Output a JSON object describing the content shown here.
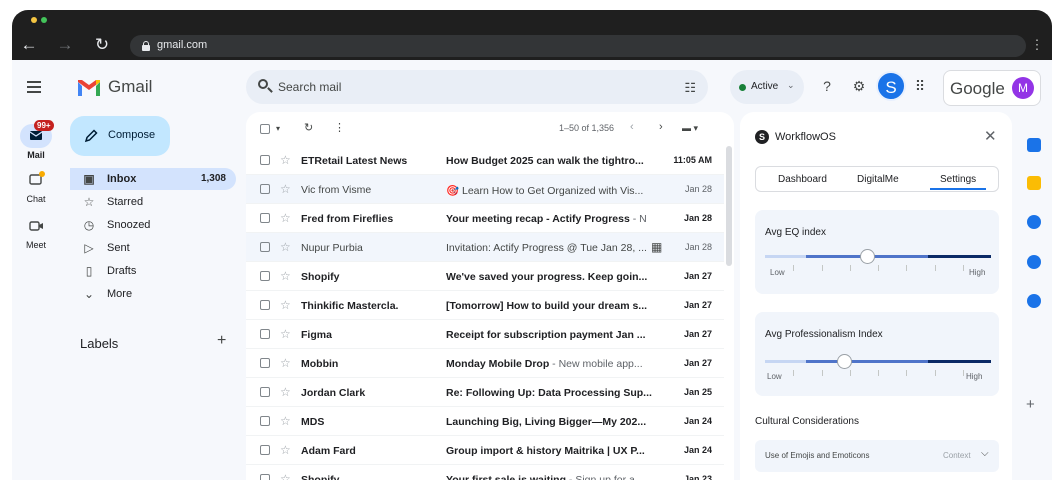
{
  "browser": {
    "url": "gmail.com"
  },
  "app": {
    "name": "Gmail",
    "compose_label": "Compose",
    "rail": [
      {
        "label": "Mail",
        "badge": "99+"
      },
      {
        "label": "Chat"
      },
      {
        "label": "Meet"
      }
    ],
    "nav": [
      {
        "label": "Inbox",
        "count": "1,308",
        "icon": "inbox-icon"
      },
      {
        "label": "Starred",
        "icon": "star-icon"
      },
      {
        "label": "Snoozed",
        "icon": "clock-icon"
      },
      {
        "label": "Sent",
        "icon": "send-icon"
      },
      {
        "label": "Drafts",
        "icon": "draft-icon"
      },
      {
        "label": "More",
        "icon": "chevron-down-icon"
      }
    ],
    "labels_title": "Labels"
  },
  "header": {
    "search_placeholder": "Search mail",
    "status": "Active",
    "avatar_letter": "S",
    "google_text": "Google",
    "account_letter": "M"
  },
  "list": {
    "range": "1–50 of 1,356",
    "rows": [
      {
        "sender": "ETRetail Latest News",
        "subject": "How Budget 2025 can walk the tightro...",
        "snippet": "",
        "date": "11:05 AM",
        "unread": true
      },
      {
        "sender": "Vic from Visme",
        "subject": "🎯 Learn How to Get Organized with Vis...",
        "snippet": "",
        "date": "Jan 28",
        "unread": false
      },
      {
        "sender": "Fred from Fireflies",
        "subject": "Your meeting recap - Actify Progress",
        "snippet": " - N",
        "date": "Jan 28",
        "unread": true
      },
      {
        "sender": "Nupur Purbia",
        "subject": "Invitation: Actify Progress @ Tue Jan 28, ...",
        "snippet": "",
        "date": "Jan 28",
        "unread": false
      },
      {
        "sender": "Shopify",
        "subject": "We've saved your progress. Keep goin...",
        "snippet": "",
        "date": "Jan 27",
        "unread": true
      },
      {
        "sender": "Thinkific Mastercla.",
        "subject": "[Tomorrow] How to build your dream s...",
        "snippet": "",
        "date": "Jan 27",
        "unread": true
      },
      {
        "sender": "Figma",
        "subject": "Receipt for subscription payment Jan ...",
        "snippet": "",
        "date": "Jan 27",
        "unread": true
      },
      {
        "sender": "Mobbin",
        "subject": "Monday Mobile Drop",
        "snippet": " - New mobile app...",
        "date": "Jan 27",
        "unread": true
      },
      {
        "sender": "Jordan Clark",
        "subject": "Re: Following Up: Data Processing Sup...",
        "snippet": "",
        "date": "Jan 25",
        "unread": true
      },
      {
        "sender": "MDS",
        "subject": "Launching Big, Living Bigger—My 202...",
        "snippet": "",
        "date": "Jan 24",
        "unread": true
      },
      {
        "sender": "Adam Fard",
        "subject": "Group import & history Maitrika | UX P...",
        "snippet": "",
        "date": "Jan 24",
        "unread": true
      },
      {
        "sender": "Shopify",
        "subject": "Your first sale is waiting",
        "snippet": " - Sign up for a...",
        "date": "Jan 23",
        "unread": true
      }
    ]
  },
  "panel": {
    "title": "WorkflowOS",
    "tabs": [
      "Dashboard",
      "DigitalMe",
      "Settings"
    ],
    "selected_tab": "Settings",
    "eq": {
      "title": "Avg EQ index",
      "low": "Low",
      "high": "High",
      "value": 0.45
    },
    "prof": {
      "title": "Avg Professionalism Index",
      "low": "Low",
      "high": "High",
      "value": 0.35
    },
    "cultural_title": "Cultural Considerations",
    "emoji_label": "Use of Emojis and Emoticons",
    "emoji_context": "Context"
  }
}
